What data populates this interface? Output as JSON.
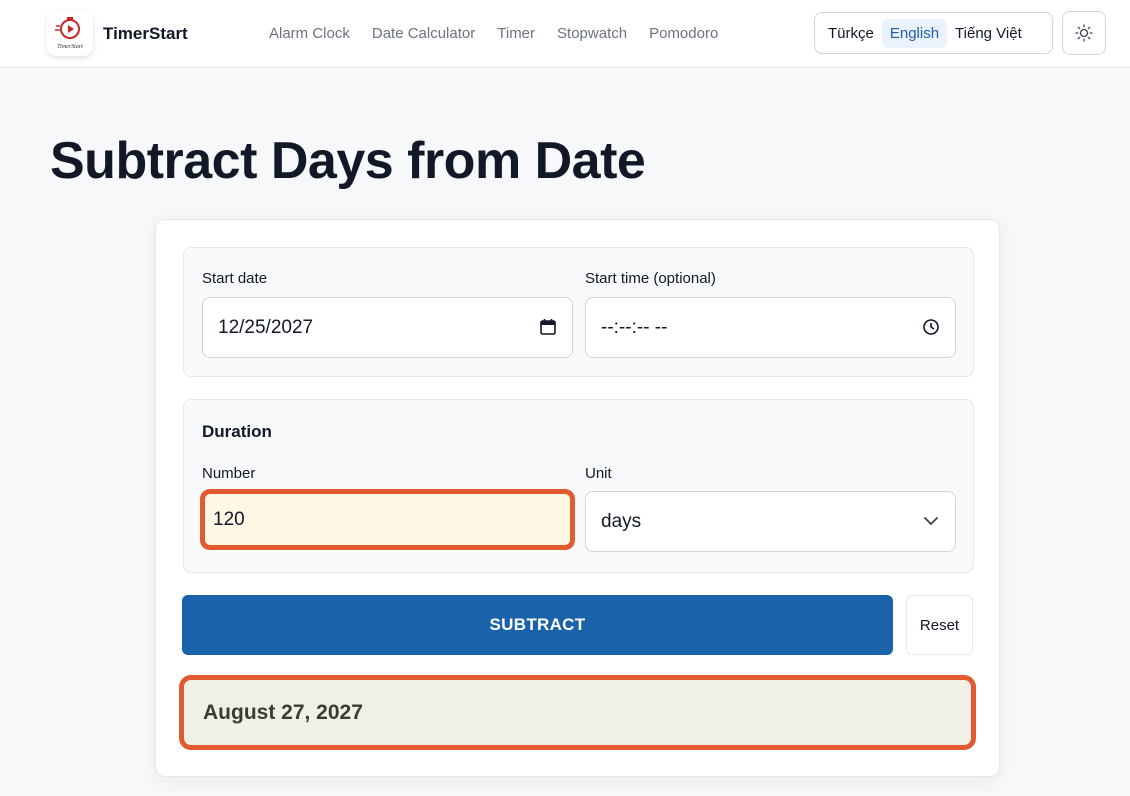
{
  "header": {
    "brand": "TimerStart",
    "logo_text": "TimerStart",
    "nav": [
      "Alarm Clock",
      "Date Calculator",
      "Timer",
      "Stopwatch",
      "Pomodoro"
    ],
    "languages": [
      "Türkçe",
      "English",
      "Tiếng Việt"
    ],
    "active_language": "English"
  },
  "page": {
    "title": "Subtract Days from Date"
  },
  "form": {
    "start_date_label": "Start date",
    "start_date_value": "12/25/2027",
    "start_time_label": "Start time (optional)",
    "start_time_value": "--:--:-- --",
    "duration_title": "Duration",
    "number_label": "Number",
    "number_value": "120",
    "unit_label": "Unit",
    "unit_value": "days",
    "subtract_label": "SUBTRACT",
    "reset_label": "Reset"
  },
  "result": {
    "text": "August 27, 2027"
  },
  "colors": {
    "primary": "#1a62a9",
    "highlight": "#e25a2f",
    "active_lang_bg": "#eaf2fb"
  }
}
